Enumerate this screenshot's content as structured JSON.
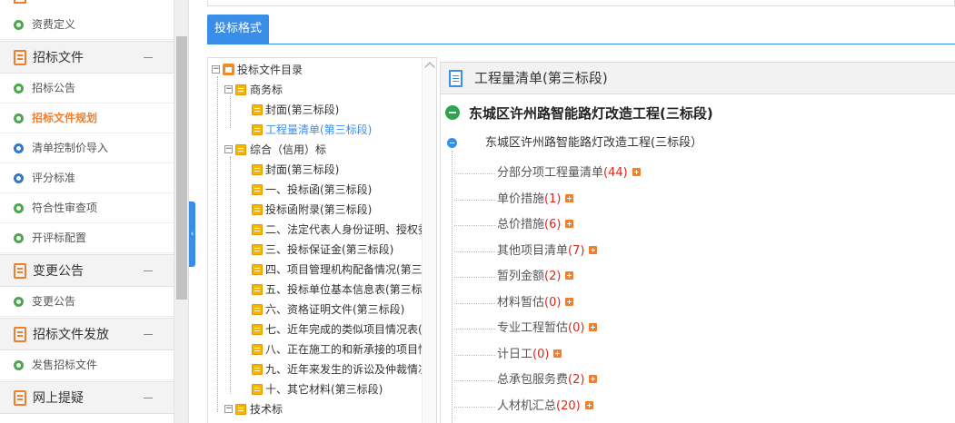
{
  "sidebar": {
    "items": [
      {
        "label": "资费定义",
        "type": "item",
        "dot": "green"
      },
      {
        "label": "招标文件",
        "type": "section"
      },
      {
        "label": "招标公告",
        "type": "item",
        "dot": "green"
      },
      {
        "label": "招标文件规划",
        "type": "item",
        "dot": "green",
        "active": true
      },
      {
        "label": "清单控制价导入",
        "type": "item",
        "dot": "blue"
      },
      {
        "label": "评分标准",
        "type": "item",
        "dot": "blue"
      },
      {
        "label": "符合性审查项",
        "type": "item",
        "dot": "green"
      },
      {
        "label": "开评标配置",
        "type": "item",
        "dot": "green"
      },
      {
        "label": "变更公告",
        "type": "section"
      },
      {
        "label": "变更公告",
        "type": "item",
        "dot": "green"
      },
      {
        "label": "招标文件发放",
        "type": "section"
      },
      {
        "label": "发售招标文件",
        "type": "item",
        "dot": "green"
      },
      {
        "label": "网上提疑",
        "type": "section"
      }
    ],
    "collapse_arrow": "‹"
  },
  "tabs": {
    "active_label": "投标格式"
  },
  "tree": {
    "nodes": [
      {
        "label": "投标文件目录",
        "level": 0,
        "toggle": "−",
        "icon": "home"
      },
      {
        "label": "商务标",
        "level": 1,
        "toggle": "−",
        "icon": "folder"
      },
      {
        "label": "封面(第三标段)",
        "level": 2,
        "icon": "folder"
      },
      {
        "label": "工程量清单(第三标段)",
        "level": 2,
        "icon": "folder",
        "selected": true
      },
      {
        "label": "综合（信用）标",
        "level": 1,
        "toggle": "−",
        "icon": "folder"
      },
      {
        "label": "封面(第三标段)",
        "level": 2,
        "icon": "folder"
      },
      {
        "label": "一、投标函(第三标段)",
        "level": 2,
        "icon": "folder"
      },
      {
        "label": "投标函附录(第三标段)",
        "level": 2,
        "icon": "folder"
      },
      {
        "label": "二、法定代表人身份证明、授权委",
        "level": 2,
        "icon": "folder"
      },
      {
        "label": "三、投标保证金(第三标段)",
        "level": 2,
        "icon": "folder"
      },
      {
        "label": "四、项目管理机构配备情况(第三",
        "level": 2,
        "icon": "folder"
      },
      {
        "label": "五、投标单位基本信息表(第三标",
        "level": 2,
        "icon": "folder"
      },
      {
        "label": "六、资格证明文件(第三标段)",
        "level": 2,
        "icon": "folder"
      },
      {
        "label": "七、近年完成的类似项目情况表(",
        "level": 2,
        "icon": "folder"
      },
      {
        "label": "八、正在施工的和新承接的项目情",
        "level": 2,
        "icon": "folder"
      },
      {
        "label": "九、近年来发生的诉讼及仲裁情况",
        "level": 2,
        "icon": "folder"
      },
      {
        "label": "十、其它材料(第三标段)",
        "level": 2,
        "icon": "folder"
      },
      {
        "label": "技术标",
        "level": 1,
        "toggle": "−",
        "icon": "folder"
      }
    ]
  },
  "content": {
    "header_title": "工程量清单(第三标段)",
    "root_label": "东城区许州路智能路灯改造工程(三标段)",
    "sub_label": "东城区许州路智能路灯改造工程(三标段）",
    "items": [
      {
        "label": "分部分项工程量清单",
        "count": "(44)"
      },
      {
        "label": "单价措施",
        "count": "(1)"
      },
      {
        "label": "总价措施",
        "count": "(6)"
      },
      {
        "label": "其他项目清单",
        "count": "(7)"
      },
      {
        "label": "暂列金额",
        "count": "(2)"
      },
      {
        "label": "材料暂估",
        "count": "(0)"
      },
      {
        "label": "专业工程暂估",
        "count": "(0)"
      },
      {
        "label": "计日工",
        "count": "(0)"
      },
      {
        "label": "总承包服务费",
        "count": "(2)"
      },
      {
        "label": "人材机汇总",
        "count": "(20)"
      }
    ]
  }
}
